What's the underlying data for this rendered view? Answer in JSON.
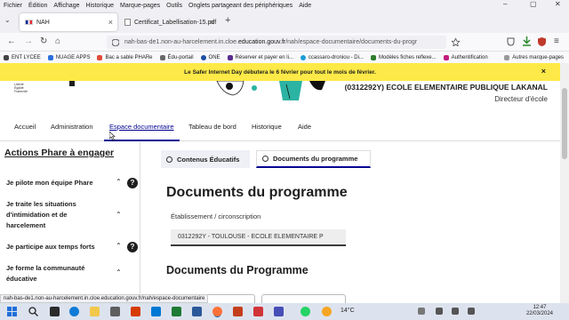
{
  "menubar": {
    "items": [
      "Fichier",
      "Édition",
      "Affichage",
      "Historique",
      "Marque-pages",
      "Outils",
      "Onglets partageant des périphériques",
      "Aide"
    ]
  },
  "window_controls": {
    "minimize": "–",
    "maximize": "▢",
    "close": "✕"
  },
  "tabs": [
    {
      "label": "NAH",
      "active": true,
      "close": "×"
    },
    {
      "label": "Certificat_Labellisation-15.pdf",
      "active": false,
      "close": "×"
    }
  ],
  "new_tab": "+",
  "overflow_tabs": "⌄",
  "nav": {
    "back": "←",
    "forward": "→",
    "reload": "↻",
    "home": "⌂",
    "url_prefix": "nah-bas-de1.non-au-harcelement.in.cloe.",
    "url_domain": "education.gouv.fr",
    "url_suffix": "/nah/espace-documentaire/documents-du-progr",
    "menu": "≡"
  },
  "bookmarks": [
    {
      "label": "ENT LYCEE",
      "color": "#444"
    },
    {
      "label": "NUAGE APPS",
      "color": "#2c6fdb"
    },
    {
      "label": "Bac a sable PHARe",
      "color": "#e04a3a"
    },
    {
      "label": "Édu-portail",
      "color": "#6a6a6a"
    },
    {
      "label": "ONE",
      "color": "#1f4fa3"
    },
    {
      "label": "Réserver et payer en li...",
      "color": "#5b2d90"
    },
    {
      "label": "ccassaro-droniou - Di...",
      "color": "#1a9bd7"
    },
    {
      "label": "Modèles fiches reflexe...",
      "color": "#2d7d2d"
    },
    {
      "label": "Authentification",
      "color": "#c21d7e"
    }
  ],
  "bookmarks_more": "Autres marque-pages",
  "banner": {
    "text": "Le Safer Internet Day débutera le 6 février pour tout le mois de février.",
    "close": "×",
    "color": "#fde947"
  },
  "header": {
    "marianne_lines": [
      "Liberté",
      "Égalité",
      "Fraternité"
    ],
    "school": "(0312292Y) ECOLE ELEMENTAIRE PUBLIQUE LAKANAL",
    "role": "Directeur d'école"
  },
  "main_nav": [
    "Accueil",
    "Administration",
    "Espace documentaire",
    "Tableau de bord",
    "Historique",
    "Aide"
  ],
  "sidebar": {
    "title": "Actions Phare à engager",
    "items": [
      {
        "label": "Je pilote mon équipe Phare",
        "help": "?"
      },
      {
        "label": "Je traite les situations d'intimidation et de harcelement",
        "help": ""
      },
      {
        "label": "Je participe aux temps forts",
        "help": "?"
      },
      {
        "label": "Je forme la communauté éducative",
        "help": ""
      }
    ],
    "chevron": "⌃"
  },
  "content": {
    "tabs": [
      "Contenus Éducatifs",
      "Documents du programme"
    ],
    "title": "Documents du programme",
    "etab_label": "Établissement / circonscription",
    "etab_value": "0312292Y - TOULOUSE - ECOLE ELEMENTAIRE P",
    "section_title": "Documents du Programme"
  },
  "status_url": "nah-bas-de1.non-au-harcelement.in.cloe.education.gouv.fr/nah/espace-documentaire",
  "taskbar": {
    "weather": "14°C",
    "time": "12:47",
    "date": "22/03/2024"
  },
  "colors": {
    "accent": "#000091",
    "banner": "#fde947"
  }
}
